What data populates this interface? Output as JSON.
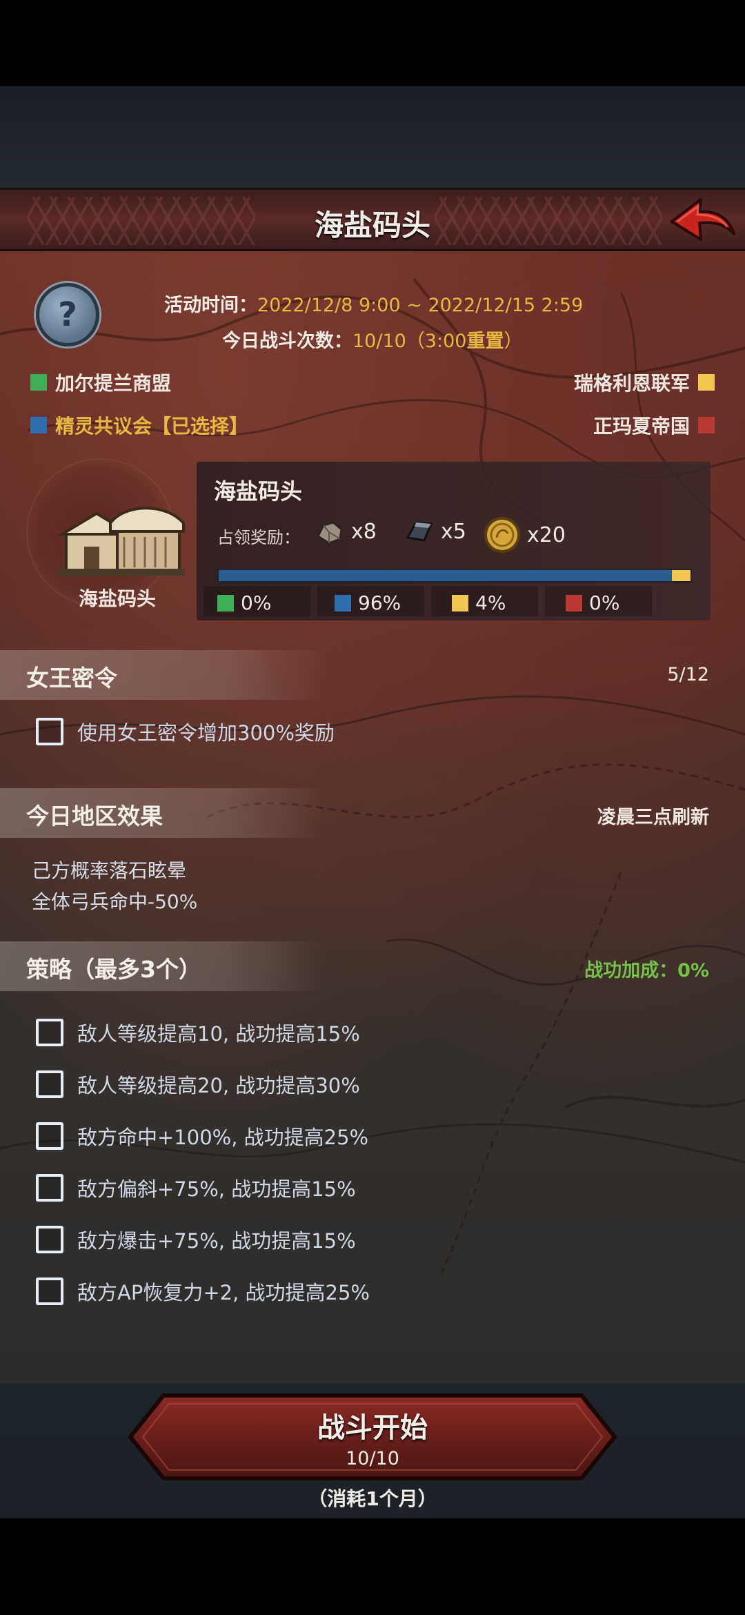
{
  "header": {
    "title": "海盐码头"
  },
  "event": {
    "time_label": "活动时间：",
    "time_value": "2022/12/8 9:00 ~ 2022/12/15 2:59",
    "battles_label": "今日战斗次数：",
    "battles_value": "10/10",
    "reset_prefix": "（3:00",
    "reset_word": "重置",
    "reset_suffix": "）"
  },
  "factions": [
    {
      "name": "加尔提兰商盟",
      "color": "#3fae55"
    },
    {
      "name": "瑞格利恩联军",
      "color": "#f3c651"
    },
    {
      "name": "精灵共议会【已选择】",
      "color": "#2f6fae"
    },
    {
      "name": "正玛夏帝国",
      "color": "#b83a33"
    }
  ],
  "location": {
    "name": "海盐码头",
    "icon_label": "海盐码头",
    "reward_label": "占领奖励：",
    "rewards": [
      {
        "icon": "stone-icon",
        "amount": "x8"
      },
      {
        "icon": "iron-ingot-icon",
        "amount": "x5"
      },
      {
        "icon": "gold-coin-icon",
        "amount": "x20"
      }
    ],
    "shares": [
      {
        "color": "#3fae55",
        "value": "0%"
      },
      {
        "color": "#2f6fae",
        "value": "96%"
      },
      {
        "color": "#f3c651",
        "value": "4%"
      },
      {
        "color": "#b83a33",
        "value": "0%"
      }
    ],
    "control_fraction": {
      "blue": 0.96,
      "yellow": 0.04
    }
  },
  "queen_order": {
    "title": "女王密令",
    "count": "5/12",
    "option": "使用女王密令增加300%奖励"
  },
  "region_effects": {
    "title": "今日地区效果",
    "refresh": "凌晨三点刷新",
    "lines": [
      "己方概率落石眩晕",
      "全体弓兵命中-50%"
    ]
  },
  "strategy": {
    "title": "策略（最多3个）",
    "bonus": "战功加成：0%",
    "options": [
      "敌人等级提高10, 战功提高15%",
      "敌人等级提高20, 战功提高30%",
      "敌方命中+100%, 战功提高25%",
      "敌方偏斜+75%, 战功提高15%",
      "敌方爆击+75%, 战功提高15%",
      "敌方AP恢复力+2, 战功提高25%"
    ]
  },
  "start": {
    "label": "战斗开始",
    "count": "10/10",
    "cost": "（消耗1个月）"
  }
}
